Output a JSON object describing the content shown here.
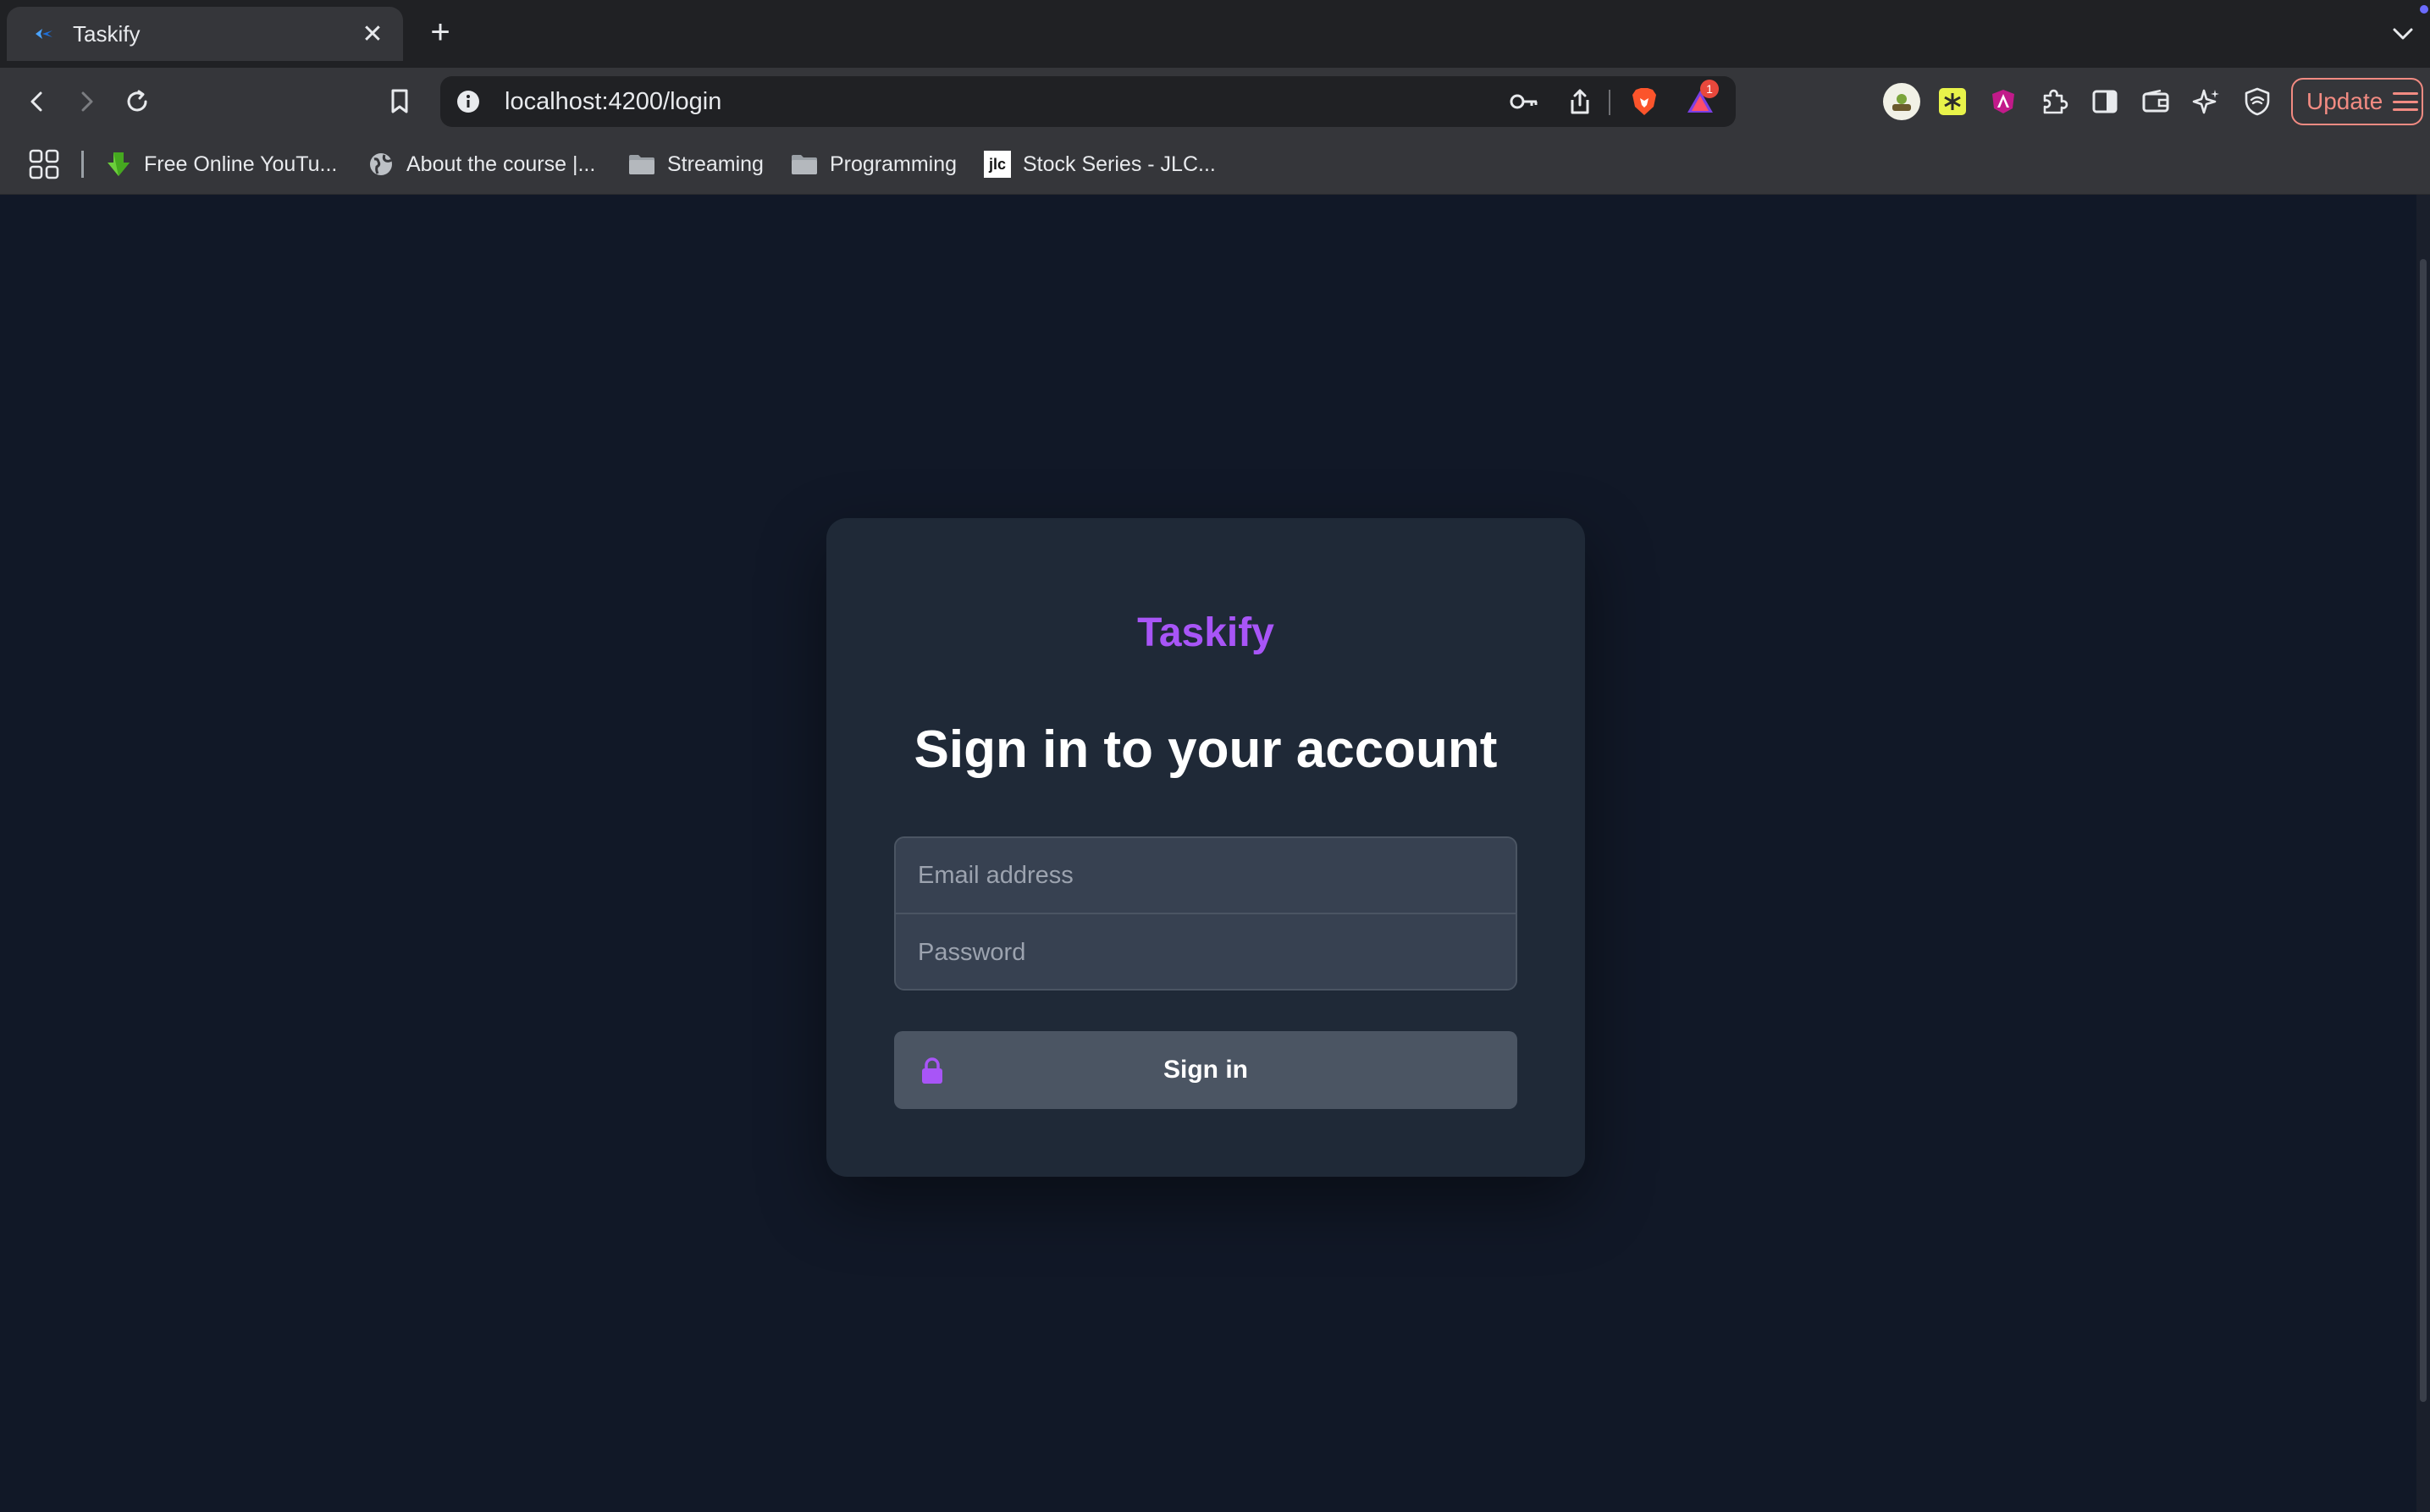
{
  "browser": {
    "tab": {
      "title": "Taskify",
      "close_label": "✕"
    },
    "new_tab_label": "+",
    "url": "localhost:4200/login",
    "update_label": "Update",
    "notification_count": "1",
    "bookmarks": [
      {
        "label": "Free Online YouTu..."
      },
      {
        "label": "About the course |..."
      },
      {
        "label": "Streaming"
      },
      {
        "label": "Programming"
      },
      {
        "label": "Stock Series - JLC..."
      }
    ],
    "bookmark_jlc_badge": "jlc"
  },
  "login": {
    "brand": "Taskify",
    "heading": "Sign in to your account",
    "email_placeholder": "Email address",
    "email_value": "",
    "password_placeholder": "Password",
    "password_value": "",
    "submit_label": "Sign in"
  },
  "colors": {
    "page_bg": "#111827",
    "card_bg": "#1f2937",
    "brand": "#a855f7",
    "button_bg": "#4b5563",
    "lock_icon": "#a855f7"
  }
}
